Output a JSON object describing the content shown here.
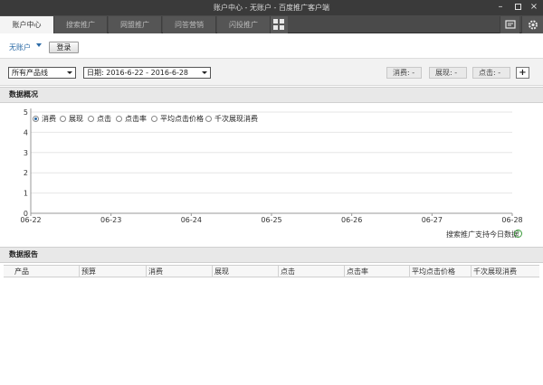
{
  "window": {
    "title": "账户中心 - 无账户 - 百度推广客户端"
  },
  "tabs": [
    {
      "label": "账户中心",
      "active": true
    },
    {
      "label": "搜索推广",
      "active": false
    },
    {
      "label": "网盟推广",
      "active": false
    },
    {
      "label": "问答营销",
      "active": false
    },
    {
      "label": "闪投推广",
      "active": false
    }
  ],
  "account": {
    "name": "无账户",
    "login_label": "登录"
  },
  "filters": {
    "product": "所有产品线",
    "date_range": "日期: 2016-6-22 - 2016-6-28",
    "stats": [
      {
        "label": "消费: -"
      },
      {
        "label": "展现: -"
      },
      {
        "label": "点击: -"
      }
    ],
    "add_label": "+"
  },
  "overview": {
    "title": "数据概况"
  },
  "legend": [
    {
      "label": "消费",
      "selected": true
    },
    {
      "label": "展现",
      "selected": false
    },
    {
      "label": "点击",
      "selected": false
    },
    {
      "label": "点击率",
      "selected": false
    },
    {
      "label": "平均点击价格",
      "selected": false
    },
    {
      "label": "千次展现消费",
      "selected": false
    }
  ],
  "chart_data": {
    "type": "line",
    "x": [
      "06-22",
      "06-23",
      "06-24",
      "06-25",
      "06-26",
      "06-27",
      "06-28"
    ],
    "series": [],
    "yticks": [
      0,
      1,
      2,
      3,
      4,
      5
    ],
    "ylim": [
      0,
      5
    ],
    "grid": true
  },
  "chart_note": "搜索推广支持今日数据",
  "report": {
    "title": "数据报告",
    "columns": [
      "产品",
      "预算",
      "消费",
      "展现",
      "点击",
      "点击率",
      "平均点击价格",
      "千次展现消费"
    ],
    "rows": []
  },
  "colors": {
    "accent": "#2b6aa6",
    "titlebar": "#3a3a3a",
    "tabbar": "#4a4a4a"
  }
}
